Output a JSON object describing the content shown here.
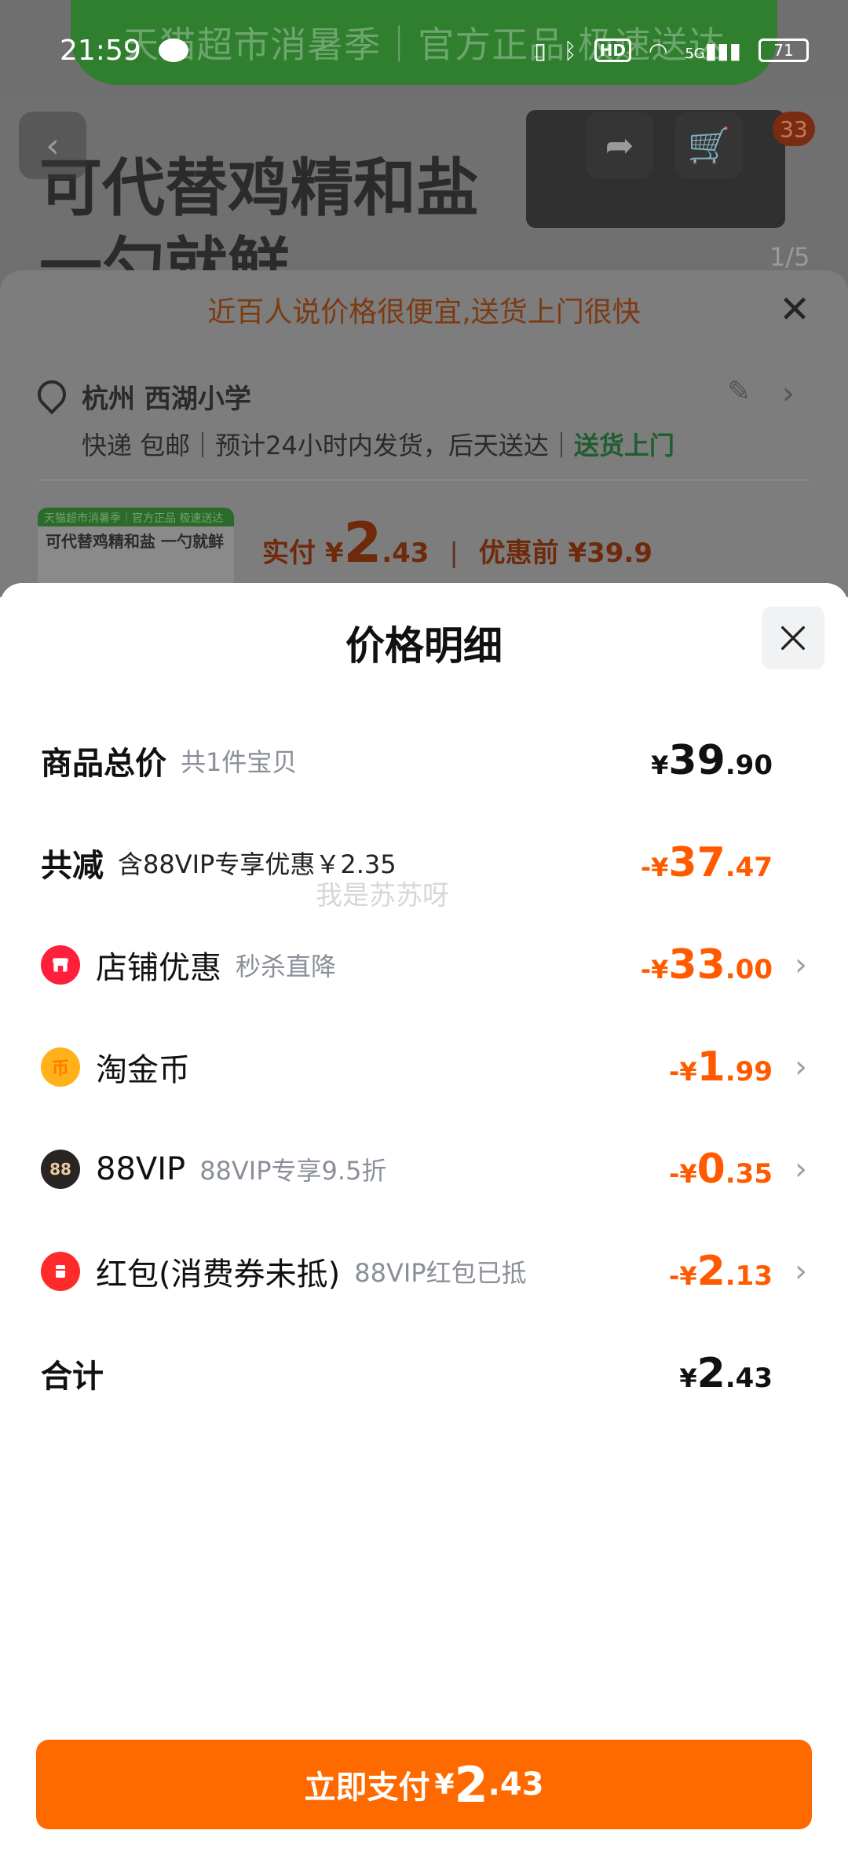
{
  "status_bar": {
    "time": "21:59",
    "signal": "5G",
    "hd": "HD",
    "battery": "71"
  },
  "background": {
    "banner": "天猫超市消暑季｜官方正品 极速送达",
    "hero_line1": "可代替鸡精和盐",
    "hero_line2": "一勺就鲜",
    "cart_badge": "33",
    "page_indicator": "1/5",
    "notice": "近百人说价格很便宜,送货上门很快",
    "address": "杭州 西湖小学",
    "delivery": "快递 包邮｜预计24小时内发货，后天送达｜",
    "delivery_highlight": "送货上门",
    "thumb_strip": "天猫超市消暑季｜官方正品 极速送达",
    "thumb_text": "可代替鸡精和盐 一勺就鲜",
    "price_label": "实付",
    "price_currency": "¥",
    "price_int": "2",
    "price_dec": ".43",
    "price_before": "优惠前 ¥39.9"
  },
  "sheet": {
    "title": "价格明细",
    "rows": [
      {
        "label": "商品总价",
        "sub": "共1件宝贝",
        "currency": "¥",
        "int": "39",
        "dec": ".90"
      },
      {
        "label": "共减",
        "sub": "含88VIP专享优惠￥2.35",
        "currency": "-¥",
        "int": "37",
        "dec": ".47"
      },
      {
        "label": "店铺优惠",
        "sub": "秒杀直降",
        "currency": "-¥",
        "int": "33",
        "dec": ".00",
        "icon": "shop-icon"
      },
      {
        "label": "淘金币",
        "sub": "",
        "currency": "-¥",
        "int": "1",
        "dec": ".99",
        "icon": "coin-icon",
        "icon_text": "币"
      },
      {
        "label": "88VIP",
        "sub": "88VIP专享9.5折",
        "currency": "-¥",
        "int": "0",
        "dec": ".35",
        "icon": "vip-icon",
        "icon_text": "88"
      },
      {
        "label": "红包(消费券未抵)",
        "sub": "88VIP红包已抵",
        "currency": "-¥",
        "int": "2",
        "dec": ".13",
        "icon": "redpacket-icon"
      },
      {
        "label": "合计",
        "sub": "",
        "currency": "¥",
        "int": "2",
        "dec": ".43"
      }
    ],
    "watermark": "我是苏苏呀"
  },
  "pay_button": {
    "label": "立即支付",
    "currency": "¥",
    "int": "2",
    "dec": ".43"
  },
  "colors": {
    "accent": "#ff6a00",
    "discount": "#ff5a00",
    "text": "#111111",
    "muted": "#8a8f99"
  }
}
